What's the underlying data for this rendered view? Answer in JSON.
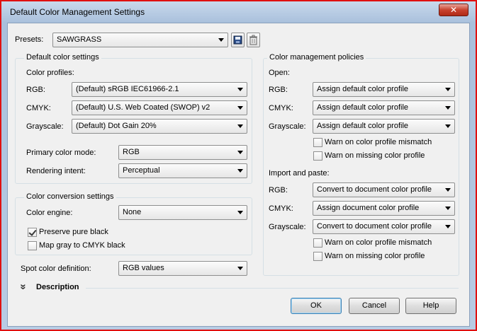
{
  "window": {
    "title": "Default Color Management Settings",
    "close_glyph": "✕"
  },
  "presets": {
    "label": "Presets:",
    "value": "SAWGRASS"
  },
  "default_color_settings": {
    "title": "Default color settings",
    "profiles_label": "Color profiles:",
    "rgb_label": "RGB:",
    "rgb_value": "(Default) sRGB IEC61966-2.1",
    "cmyk_label": "CMYK:",
    "cmyk_value": "(Default) U.S. Web Coated (SWOP) v2",
    "grayscale_label": "Grayscale:",
    "grayscale_value": "(Default) Dot Gain 20%",
    "primary_mode_label": "Primary color mode:",
    "primary_mode_value": "RGB",
    "rendering_intent_label": "Rendering intent:",
    "rendering_intent_value": "Perceptual"
  },
  "conversion_settings": {
    "title": "Color conversion settings",
    "engine_label": "Color engine:",
    "engine_value": "None",
    "preserve_black_label": "Preserve pure black",
    "preserve_black_checked": true,
    "map_gray_label": "Map gray to CMYK black",
    "map_gray_checked": false
  },
  "spot": {
    "label": "Spot color definition:",
    "value": "RGB values"
  },
  "policies": {
    "title": "Color management policies",
    "open_label": "Open:",
    "open_rgb_label": "RGB:",
    "open_rgb_value": "Assign default color profile",
    "open_cmyk_label": "CMYK:",
    "open_cmyk_value": "Assign default color profile",
    "open_gray_label": "Grayscale:",
    "open_gray_value": "Assign default color profile",
    "open_warn_mismatch": "Warn on color profile mismatch",
    "open_warn_missing": "Warn on missing color profile",
    "import_label": "Import and paste:",
    "import_rgb_label": "RGB:",
    "import_rgb_value": "Convert to document color profile",
    "import_cmyk_label": "CMYK:",
    "import_cmyk_value": "Assign document color profile",
    "import_gray_label": "Grayscale:",
    "import_gray_value": "Convert to document color profile",
    "import_warn_mismatch": "Warn on color profile mismatch",
    "import_warn_missing": "Warn on missing color profile"
  },
  "description": {
    "label": "Description",
    "glyph": "»"
  },
  "buttons": {
    "ok": "OK",
    "cancel": "Cancel",
    "help": "Help"
  },
  "colors": {
    "window_border": "#e01010",
    "client_bg": "#f0f0f0",
    "default_button_border": "#3c7fb1"
  },
  "icons": [
    "save-icon",
    "delete-icon",
    "chevron-down-icon",
    "close-icon"
  ]
}
